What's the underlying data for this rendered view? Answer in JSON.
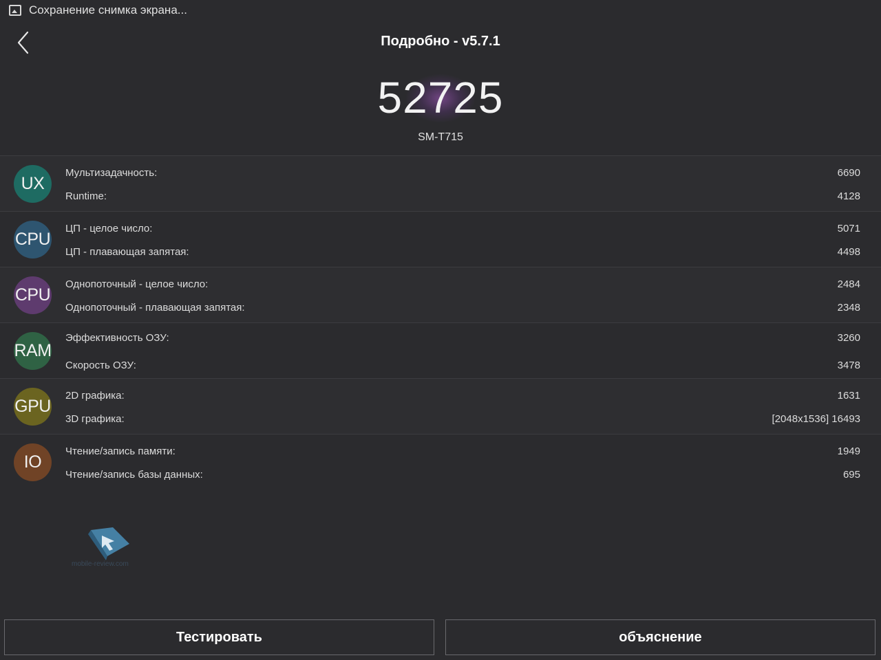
{
  "status_bar": {
    "notification_text": "Сохранение снимка экрана..."
  },
  "header": {
    "title": "Подробно - v5.7.1"
  },
  "score": {
    "total": "52725",
    "device": "SM-T715"
  },
  "categories": [
    {
      "badge": "UX",
      "color": "#1e6b62",
      "items": [
        {
          "label": "Мультизадачность:",
          "value": "6690"
        },
        {
          "label": "Runtime:",
          "value": "4128"
        }
      ]
    },
    {
      "badge": "CPU",
      "color": "#2e5570",
      "items": [
        {
          "label": "ЦП - целое число:",
          "value": "5071"
        },
        {
          "label": "ЦП - плавающая запятая:",
          "value": "4498"
        }
      ]
    },
    {
      "badge": "CPU",
      "color": "#5e3b6e",
      "items": [
        {
          "label": "Однопоточный - целое число:",
          "value": "2484"
        },
        {
          "label": "Однопоточный - плавающая запятая:",
          "value": "2348"
        }
      ]
    },
    {
      "badge": "RAM",
      "color": "#2f6244",
      "items": [
        {
          "label": "Эффективность ОЗУ:",
          "value": "3260"
        },
        {
          "label": "Скорость ОЗУ:",
          "value": "3478"
        }
      ]
    },
    {
      "badge": "GPU",
      "color": "#6b6420",
      "items": [
        {
          "label": "2D графика:",
          "value": "1631"
        },
        {
          "label": "3D графика:",
          "value": "[2048x1536] 16493"
        }
      ]
    },
    {
      "badge": "IO",
      "color": "#704326",
      "items": [
        {
          "label": "Чтение/запись памяти:",
          "value": "1949"
        },
        {
          "label": "Чтение/запись базы данных:",
          "value": "695"
        }
      ]
    }
  ],
  "watermark": {
    "text": "mobile-review.com"
  },
  "buttons": {
    "test": "Тестировать",
    "explain": "объяснение"
  }
}
